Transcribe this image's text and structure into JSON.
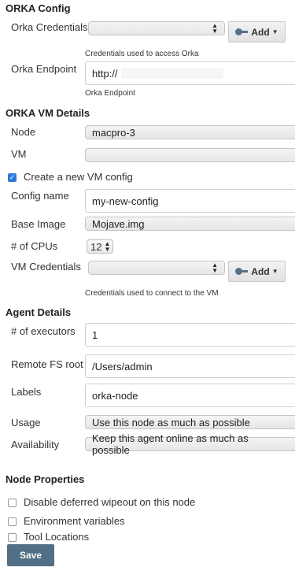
{
  "orka_config": {
    "title": "ORKA Config",
    "credentials_label": "Orka Credentials",
    "credentials_value": "",
    "credentials_hint": "Credentials used to access Orka",
    "add_label": "Add",
    "endpoint_label": "Orka Endpoint",
    "endpoint_value": "http://",
    "endpoint_hint": "Orka Endpoint"
  },
  "vm_details": {
    "title": "ORKA VM Details",
    "node_label": "Node",
    "node_value": "macpro-3",
    "vm_label": "VM",
    "vm_value": "",
    "create_new_label": "Create a new VM config",
    "create_new_checked": true,
    "config_name_label": "Config name",
    "config_name_value": "my-new-config",
    "base_image_label": "Base Image",
    "base_image_value": "Mojave.img",
    "cpus_label": "# of CPUs",
    "cpus_value": "12",
    "vm_credentials_label": "VM Credentials",
    "vm_credentials_value": "",
    "vm_credentials_hint": "Credentials used to connect to the VM",
    "add_label": "Add"
  },
  "agent_details": {
    "title": "Agent Details",
    "executors_label": "# of executors",
    "executors_value": "1",
    "remote_fs_label": "Remote FS root",
    "remote_fs_value": "/Users/admin",
    "labels_label": "Labels",
    "labels_value": "orka-node",
    "usage_label": "Usage",
    "usage_value": "Use this node as much as possible",
    "availability_label": "Availability",
    "availability_value": "Keep this agent online as much as possible"
  },
  "node_properties": {
    "title": "Node Properties",
    "items": [
      {
        "label": "Disable deferred wipeout on this node",
        "checked": false
      },
      {
        "label": "Environment variables",
        "checked": false
      },
      {
        "label": "Tool Locations",
        "checked": false
      }
    ]
  },
  "save_label": "Save",
  "colors": {
    "accent_blue": "#2f7ad9",
    "save_button": "#516f86"
  }
}
